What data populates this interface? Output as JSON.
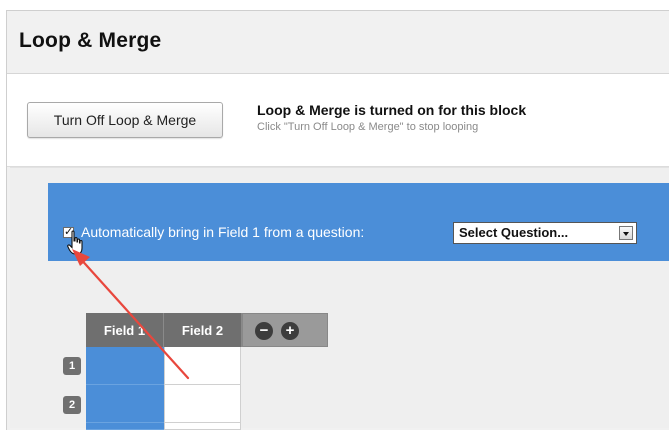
{
  "header": {
    "title": "Loop & Merge"
  },
  "controls": {
    "turn_off_button": "Turn Off Loop & Merge",
    "status_title": "Loop & Merge is turned on for this block",
    "status_subtitle": "Click \"Turn Off Loop & Merge\" to stop looping"
  },
  "auto": {
    "checkbox_checked": true,
    "label": "Automatically bring in Field 1 from a question:",
    "select_value": "Select Question..."
  },
  "table": {
    "headers": [
      "Field 1",
      "Field 2"
    ],
    "minus_symbol": "−",
    "plus_symbol": "+",
    "rows": [
      "1",
      "2"
    ]
  },
  "colors": {
    "accent_blue": "#4b8ed8",
    "header_gray": "#6f6f6f",
    "annotation_arrow": "#e8473d"
  },
  "icons": {
    "row_remove": "minus-circle-icon",
    "row_add": "plus-circle-icon",
    "pointer": "hand-cursor-icon"
  }
}
